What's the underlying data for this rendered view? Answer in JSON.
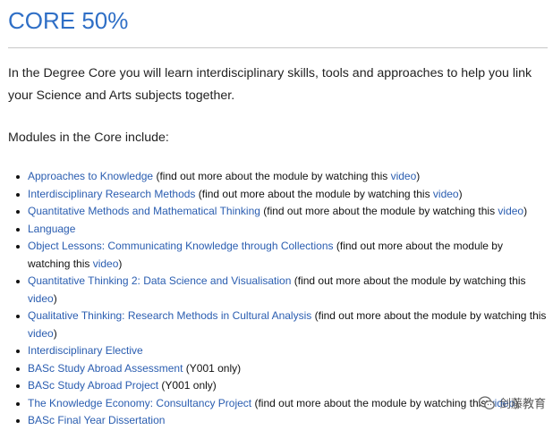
{
  "title": "CORE 50%",
  "intro": "In the Degree Core you will learn interdisciplinary skills, tools and approaches to help you link your Science and Arts subjects together.",
  "modules_heading": "Modules in the Core include:",
  "modules": [
    {
      "name": "Approaches to Knowledge",
      "before": " (find out more about the module by watching this ",
      "video": "video",
      "after": ")"
    },
    {
      "name": "Interdisciplinary Research Methods",
      "before": " (find out more about the module by watching this ",
      "video": "video",
      "after": ")"
    },
    {
      "name": "Quantitative Methods and Mathematical Thinking",
      "before": " (find out more about the module by watching this ",
      "video": "video",
      "after": ")"
    },
    {
      "name": "Language",
      "before": "",
      "video": "",
      "after": ""
    },
    {
      "name": "Object Lessons: Communicating Knowledge through Collections",
      "before": " (find out more about the module by watching this ",
      "video": "video",
      "after": ")"
    },
    {
      "name": "Quantitative Thinking 2: Data Science and Visualisation",
      "before": " (find out more about the module by watching this ",
      "video": "video",
      "after": ")"
    },
    {
      "name": "Qualitative Thinking: Research Methods in Cultural Analysis",
      "before": " (find out more about the module by watching this ",
      "video": "video",
      "after": ")"
    },
    {
      "name": "Interdisciplinary Elective",
      "before": "",
      "video": "",
      "after": ""
    },
    {
      "name": "BASc Study Abroad Assessment",
      "before": " (Y001 only)",
      "video": "",
      "after": ""
    },
    {
      "name": "BASc Study Abroad Project",
      "before": " (Y001 only)",
      "video": "",
      "after": ""
    },
    {
      "name": "The Knowledge Economy: Consultancy Project",
      "before": " (find out more about the module by watching this ",
      "video": "video",
      "after": ")"
    },
    {
      "name": "BASc Final Year Dissertation",
      "before": "",
      "video": "",
      "after": ""
    }
  ],
  "watermark": {
    "text": "剑藤教育",
    "icon": "wechat-icon"
  },
  "colors": {
    "heading": "#2f6fc6",
    "link": "#2a5db0",
    "text": "#222222",
    "rule": "#c8c8c8"
  }
}
